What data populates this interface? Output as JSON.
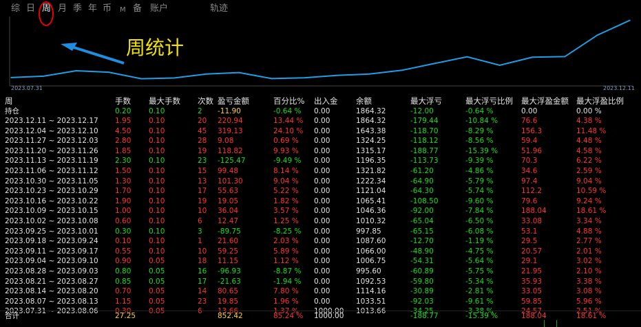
{
  "tabs": [
    {
      "label": "综",
      "active": false
    },
    {
      "label": "日",
      "active": false
    },
    {
      "label": "周",
      "active": true
    },
    {
      "label": "月",
      "active": false
    },
    {
      "label": "季",
      "active": false
    },
    {
      "label": "年",
      "active": false
    },
    {
      "label": "币",
      "active": false
    },
    {
      "label": "M",
      "active": false
    },
    {
      "label": "备",
      "active": false
    },
    {
      "label": "账户",
      "active": false
    },
    {
      "label": "轨迹",
      "active": false
    }
  ],
  "annotation": {
    "text": "周统计",
    "color": "#f2e200"
  },
  "chart_data": {
    "type": "line",
    "title": "",
    "x_start_label": "2023.07.31",
    "x_end_label": "2023.12.11",
    "x": [
      "2023.07.31",
      "2023.08.07",
      "2023.08.14",
      "2023.08.21",
      "2023.08.28",
      "2023.09.04",
      "2023.09.11",
      "2023.09.18",
      "2023.09.25",
      "2023.10.02",
      "2023.10.09",
      "2023.10.16",
      "2023.10.23",
      "2023.10.30",
      "2023.11.06",
      "2023.11.13",
      "2023.11.20",
      "2023.11.27",
      "2023.12.04",
      "2023.12.11"
    ],
    "series": [
      {
        "values": [
          1013.66,
          1033.51,
          1114.16,
          1092.53,
          995.6,
          1006.75,
          1066.0,
          1087.6,
          997.85,
          1010.32,
          1046.36,
          1065.41,
          1121.04,
          1222.34,
          1321.82,
          1196.35,
          1315.17,
          1324.25,
          1643.38,
          1864.32
        ]
      }
    ],
    "color": "#1e9fe6"
  },
  "table": {
    "headers": [
      "周",
      "手数",
      "最大手数",
      "次数",
      "盈亏金额",
      "百分比%",
      "出入金",
      "余额",
      "最大浮亏",
      "最大浮亏比例",
      "最大浮盈金额",
      "最大浮盈比例"
    ],
    "holding": {
      "label": "持仓",
      "values": [
        "0.20",
        "0.10",
        "2",
        "-11.90",
        "-0.64 %",
        "0.00",
        "1864.32",
        "-12.00",
        "-0.64 %",
        "0.00",
        "0.00 %"
      ]
    },
    "rows": [
      [
        "2023.12.11 ~ 2023.12.17",
        "1.95",
        "0.10",
        "20",
        "220.94",
        "13.44 %",
        "0.00",
        "1864.32",
        "-179.44",
        "-10.84 %",
        "76.6",
        "4.38 %"
      ],
      [
        "2023.12.04 ~ 2023.12.10",
        "4.50",
        "0.10",
        "45",
        "319.13",
        "24.10 %",
        "0.00",
        "1643.38",
        "-118.70",
        "-8.29 %",
        "156.3",
        "11.48 %"
      ],
      [
        "2023.11.27 ~ 2023.12.03",
        "2.80",
        "0.10",
        "28",
        "9.08",
        "0.69 %",
        "0.00",
        "1324.25",
        "-118.12",
        "-8.56 %",
        "59.4",
        "4.48 %"
      ],
      [
        "2023.11.20 ~ 2023.11.26",
        "1.85",
        "0.10",
        "19",
        "118.82",
        "9.93 %",
        "0.00",
        "1315.17",
        "-188.77",
        "-15.39 %",
        "51.96",
        "4.58 %"
      ],
      [
        "2023.11.13 ~ 2023.11.19",
        "2.30",
        "0.10",
        "23",
        "-125.47",
        "-9.49 %",
        "0.00",
        "1196.35",
        "-113.73",
        "-9.39 %",
        "70.3",
        "6.22 %"
      ],
      [
        "2023.11.06 ~ 2023.11.12",
        "1.50",
        "0.10",
        "15",
        "99.48",
        "8.14 %",
        "0.00",
        "1321.82",
        "-61.20",
        "-4.86 %",
        "34.6",
        "2.59 %"
      ],
      [
        "2023.10.30 ~ 2023.11.05",
        "1.30",
        "0.10",
        "13",
        "101.30",
        "9.04 %",
        "0.00",
        "1222.34",
        "-64.90",
        "-5.79 %",
        "97.4",
        "9.04 %"
      ],
      [
        "2023.10.23 ~ 2023.10.29",
        "1.70",
        "0.10",
        "17",
        "55.63",
        "5.22 %",
        "0.00",
        "1121.04",
        "-64.30",
        "-5.74 %",
        "112.2",
        "10.59 %"
      ],
      [
        "2023.10.16 ~ 2023.10.22",
        "1.90",
        "0.10",
        "19",
        "19.05",
        "1.82 %",
        "0.00",
        "1065.41",
        "-108.50",
        "-9.60 %",
        "79.6",
        "9.24 %"
      ],
      [
        "2023.10.09 ~ 2023.10.15",
        "1.00",
        "0.10",
        "10",
        "36.04",
        "3.57 %",
        "0.00",
        "1046.36",
        "-92.00",
        "-7.84 %",
        "188.04",
        "18.61 %"
      ],
      [
        "2023.10.02 ~ 2023.10.08",
        "0.60",
        "0.10",
        "6",
        "12.47",
        "1.25 %",
        "0.00",
        "1010.32",
        "-65.04",
        "-6.50 %",
        "33.08",
        "3.34 %"
      ],
      [
        "2023.09.25 ~ 2023.10.01",
        "0.30",
        "0.10",
        "3",
        "-89.75",
        "-8.25 %",
        "0.00",
        "997.85",
        "-65.15",
        "-6.08 %",
        "53.1",
        "4.88 %"
      ],
      [
        "2023.09.18 ~ 2023.09.24",
        "0.10",
        "0.10",
        "1",
        "21.60",
        "2.03 %",
        "0.00",
        "1087.60",
        "-12.70",
        "-1.19 %",
        "29.5",
        "2.77 %"
      ],
      [
        "2023.09.11 ~ 2023.09.17",
        "0.55",
        "0.10",
        "10",
        "59.25",
        "5.89 %",
        "0.00",
        "1066.00",
        "-48.90",
        "-4.75 %",
        "20.57",
        "2.01 %"
      ],
      [
        "2023.09.04 ~ 2023.09.10",
        "0.90",
        "0.05",
        "18",
        "11.15",
        "1.12 %",
        "0.00",
        "1006.75",
        "-54.31",
        "-5.64 %",
        "29.1",
        "3.02 %"
      ],
      [
        "2023.08.28 ~ 2023.09.03",
        "0.80",
        "0.05",
        "16",
        "-96.93",
        "-8.87 %",
        "0.00",
        "995.60",
        "-60.89",
        "-5.75 %",
        "21.95",
        "2.10 %"
      ],
      [
        "2023.08.21 ~ 2023.08.27",
        "0.85",
        "0.05",
        "17",
        "-21.63",
        "-1.94 %",
        "0.00",
        "1092.53",
        "-59.80",
        "-5.34 %",
        "35.93",
        "3.38 %"
      ],
      [
        "2023.08.14 ~ 2023.08.20",
        "0.70",
        "0.05",
        "14",
        "80.65",
        "7.80 %",
        "0.00",
        "1114.16",
        "-30.89",
        "-2.81 %",
        "33.05",
        "3.08 %"
      ],
      [
        "2023.08.07 ~ 2023.08.13",
        "1.15",
        "0.05",
        "23",
        "19.85",
        "1.96 %",
        "0.00",
        "1033.51",
        "-92.03",
        "-9.61 %",
        "59.85",
        "5.96 %"
      ],
      [
        "2023.07.31 ~ 2023.08.06",
        "0.30",
        "0.05",
        "6",
        "13.66",
        "1.37 %",
        "1000.00",
        "1013.66",
        "-34.25",
        "-3.38 %",
        "24.57",
        "2.51 %"
      ]
    ],
    "total": {
      "label": "合计",
      "values": [
        "27.25",
        "",
        "",
        "852.42",
        "85.24 %",
        "1000.00",
        "",
        "-188.77",
        "-15.39 %",
        "188.04",
        "18.61 %"
      ]
    }
  }
}
